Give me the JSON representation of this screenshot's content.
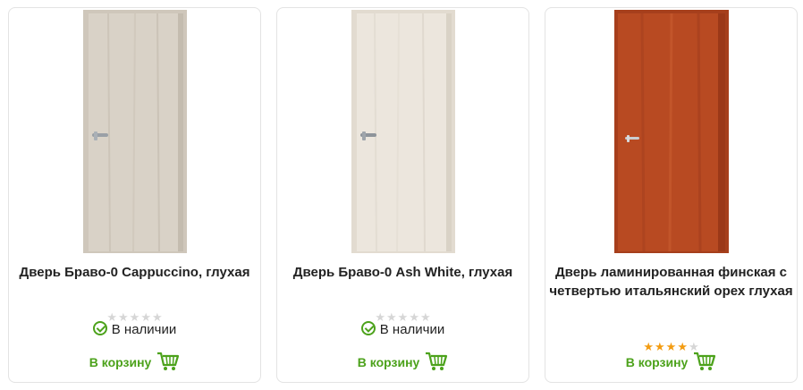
{
  "products": [
    {
      "title": "Дверь Браво-0 Cappuccino, глухая",
      "rating": 0,
      "availability": "В наличии",
      "cart_label": "В корзину",
      "door_color": "#d9d2c7",
      "frame_color": "#cfc7bb"
    },
    {
      "title": "Дверь Браво-0 Ash White, глухая",
      "rating": 0,
      "availability": "В наличии",
      "cart_label": "В корзину",
      "door_color": "#ece6dd",
      "frame_color": "#e2dbd0"
    },
    {
      "title": "Дверь ламинированная финская с четвертью итальянский орех глухая",
      "rating": 4,
      "availability": "",
      "cart_label": "В корзину",
      "door_color": "#b84a22",
      "frame_color": "#a63f1c"
    }
  ],
  "colors": {
    "accent_green": "#4ca21b",
    "star_filled": "#f39c12",
    "star_empty": "#d6d6d6"
  }
}
